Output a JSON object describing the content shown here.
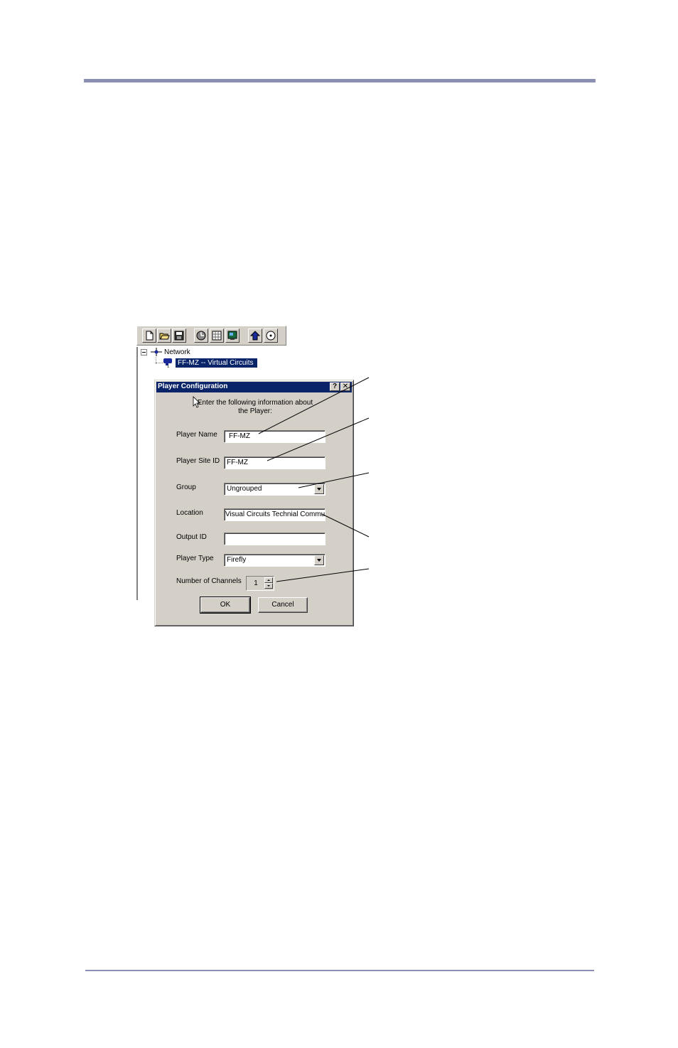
{
  "toolbar": {
    "buttons": [
      {
        "name": "new-document-icon"
      },
      {
        "name": "open-folder-icon"
      },
      {
        "name": "save-disk-icon"
      },
      {
        "name": "schedule-clock-icon"
      },
      {
        "name": "grid-table-icon"
      },
      {
        "name": "monitor-display-icon"
      },
      {
        "name": "upload-arrow-icon"
      },
      {
        "name": "disc-icon"
      }
    ]
  },
  "tree": {
    "root_label": "Network",
    "child_label": "FF-MZ -- Virtual Circuits"
  },
  "dialog": {
    "title": "Player Configuration",
    "help_label": "?",
    "close_label": "✕",
    "intro": "Enter the following information about the Player:",
    "fields": {
      "player_name": {
        "label": "Player Name",
        "value": "FF-MZ"
      },
      "player_site_id": {
        "label": "Player Site ID",
        "value": "FF-MZ"
      },
      "group": {
        "label": "Group",
        "value": "Ungrouped"
      },
      "location": {
        "label": "Location",
        "value": "Visual Circuits Technial Commu"
      },
      "output_id": {
        "label": "Output ID",
        "value": ""
      },
      "player_type": {
        "label": "Player Type",
        "value": "Firefly"
      },
      "channels": {
        "label": "Number of Channels",
        "value": "1"
      }
    },
    "ok_label": "OK",
    "cancel_label": "Cancel"
  },
  "colors": {
    "rule": "#8b8fb3",
    "titlebar": "#0a246a",
    "dialog_face": "#d4d0c8"
  }
}
